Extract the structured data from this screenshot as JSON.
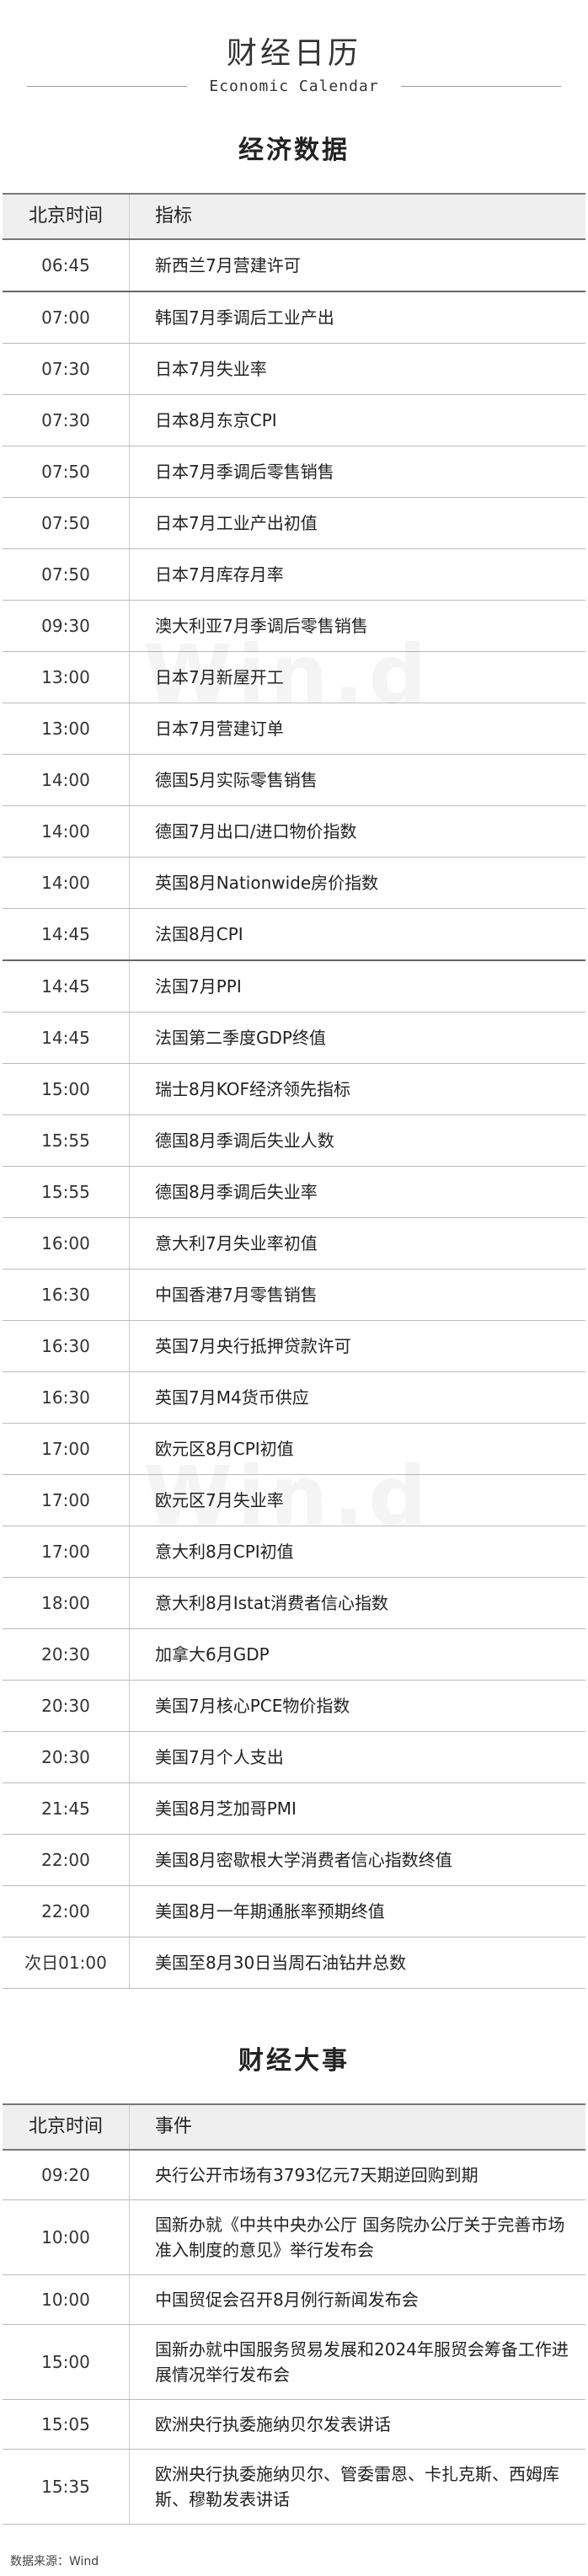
{
  "header": {
    "title_cn": "财经日历",
    "title_en": "Economic Calendar"
  },
  "econ": {
    "title": "经济数据",
    "col_time": "北京时间",
    "col_item": "指标",
    "rows": [
      {
        "time": "06:45",
        "item": "新西兰7月营建许可"
      },
      {
        "time": "07:00",
        "item": "韩国7月季调后工业产出"
      },
      {
        "time": "07:30",
        "item": "日本7月失业率"
      },
      {
        "time": "07:30",
        "item": "日本8月东京CPI"
      },
      {
        "time": "07:50",
        "item": "日本7月季调后零售销售"
      },
      {
        "time": "07:50",
        "item": "日本7月工业产出初值"
      },
      {
        "time": "07:50",
        "item": "日本7月库存月率"
      },
      {
        "time": "09:30",
        "item": "澳大利亚7月季调后零售销售"
      },
      {
        "time": "13:00",
        "item": "日本7月新屋开工"
      },
      {
        "time": "13:00",
        "item": "日本7月营建订单"
      },
      {
        "time": "14:00",
        "item": "德国5月实际零售销售"
      },
      {
        "time": "14:00",
        "item": "德国7月出口/进口物价指数"
      },
      {
        "time": "14:00",
        "item": "英国8月Nationwide房价指数"
      },
      {
        "time": "14:45",
        "item": "法国8月CPI"
      },
      {
        "time": "14:45",
        "item": "法国7月PPI"
      },
      {
        "time": "14:45",
        "item": "法国第二季度GDP终值"
      },
      {
        "time": "15:00",
        "item": "瑞士8月KOF经济领先指标"
      },
      {
        "time": "15:55",
        "item": "德国8月季调后失业人数"
      },
      {
        "time": "15:55",
        "item": "德国8月季调后失业率"
      },
      {
        "time": "16:00",
        "item": "意大利7月失业率初值"
      },
      {
        "time": "16:30",
        "item": "中国香港7月零售销售"
      },
      {
        "time": "16:30",
        "item": "英国7月央行抵押贷款许可"
      },
      {
        "time": "16:30",
        "item": "英国7月M4货币供应"
      },
      {
        "time": "17:00",
        "item": "欧元区8月CPI初值"
      },
      {
        "time": "17:00",
        "item": "欧元区7月失业率"
      },
      {
        "time": "17:00",
        "item": "意大利8月CPI初值"
      },
      {
        "time": "18:00",
        "item": "意大利8月Istat消费者信心指数"
      },
      {
        "time": "20:30",
        "item": "加拿大6月GDP"
      },
      {
        "time": "20:30",
        "item": "美国7月核心PCE物价指数"
      },
      {
        "time": "20:30",
        "item": "美国7月个人支出"
      },
      {
        "time": "21:45",
        "item": "美国8月芝加哥PMI"
      },
      {
        "time": "22:00",
        "item": "美国8月密歇根大学消费者信心指数终值"
      },
      {
        "time": "22:00",
        "item": "美国8月一年期通胀率预期终值"
      },
      {
        "time": "次日01:00",
        "item": "美国至8月30日当周石油钻井总数"
      }
    ]
  },
  "events": {
    "title": "财经大事",
    "col_time": "北京时间",
    "col_item": "事件",
    "rows": [
      {
        "time": "09:20",
        "item": "央行公开市场有3793亿元7天期逆回购到期"
      },
      {
        "time": "10:00",
        "item": "国新办就《中共中央办公厅 国务院办公厅关于完善市场准入制度的意见》举行发布会"
      },
      {
        "time": "10:00",
        "item": "中国贸促会召开8月例行新闻发布会"
      },
      {
        "time": "15:00",
        "item": "国新办就中国服务贸易发展和2024年服贸会筹备工作进展情况举行发布会"
      },
      {
        "time": "15:05",
        "item": "欧洲央行执委施纳贝尔发表讲话"
      },
      {
        "time": "15:35",
        "item": "欧洲央行执委施纳贝尔、管委雷恩、卡扎克斯、西姆库斯、穆勒发表讲话"
      }
    ]
  },
  "footer": {
    "source": "数据来源：Wind"
  },
  "watermark": {
    "text": "Win.d"
  }
}
